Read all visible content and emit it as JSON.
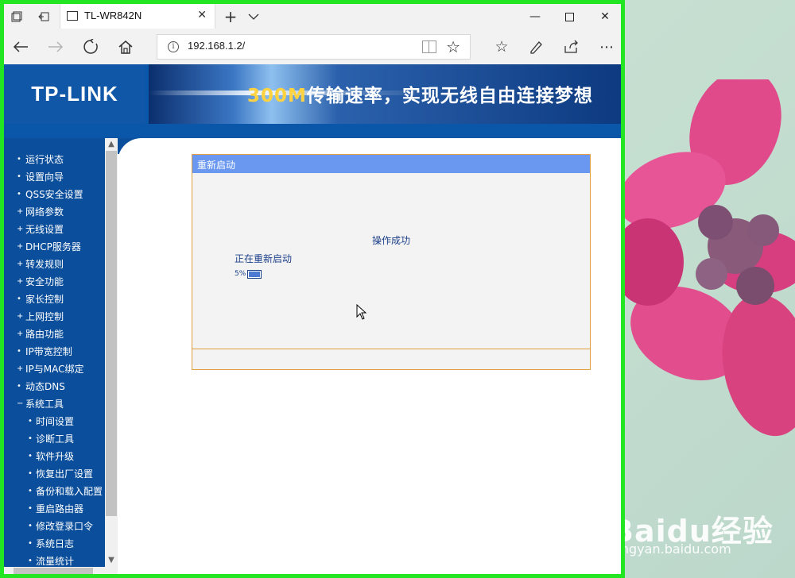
{
  "browser": {
    "tab_title": "TL-WR842N",
    "url": "192.168.1.2/"
  },
  "banner": {
    "logo": "TP-LINK",
    "slogan_highlight": "300M",
    "slogan_rest": "传输速率，实现无线自由连接梦想"
  },
  "sidebar": {
    "items": [
      {
        "label": "运行状态",
        "mark": "•"
      },
      {
        "label": "设置向导",
        "mark": "•"
      },
      {
        "label": "QSS安全设置",
        "mark": "•"
      },
      {
        "label": "网络参数",
        "mark": "+"
      },
      {
        "label": "无线设置",
        "mark": "+"
      },
      {
        "label": "DHCP服务器",
        "mark": "+"
      },
      {
        "label": "转发规则",
        "mark": "+"
      },
      {
        "label": "安全功能",
        "mark": "+"
      },
      {
        "label": "家长控制",
        "mark": "•"
      },
      {
        "label": "上网控制",
        "mark": "+"
      },
      {
        "label": "路由功能",
        "mark": "+"
      },
      {
        "label": "IP带宽控制",
        "mark": "•"
      },
      {
        "label": "IP与MAC绑定",
        "mark": "+"
      },
      {
        "label": "动态DNS",
        "mark": "•"
      },
      {
        "label": "系统工具",
        "mark": "−"
      },
      {
        "label": "时间设置",
        "mark": "•"
      },
      {
        "label": "诊断工具",
        "mark": "•"
      },
      {
        "label": "软件升级",
        "mark": "•"
      },
      {
        "label": "恢复出厂设置",
        "mark": "•"
      },
      {
        "label": "备份和载入配置",
        "mark": "•"
      },
      {
        "label": "重启路由器",
        "mark": "•"
      },
      {
        "label": "修改登录口令",
        "mark": "•"
      },
      {
        "label": "系统日志",
        "mark": "•"
      },
      {
        "label": "流量统计",
        "mark": "•"
      }
    ]
  },
  "panel": {
    "title": "重新启动",
    "status": "操作成功",
    "message": "正在重新启动",
    "progress_label": "5%",
    "progress_fraction": 0.05
  },
  "watermark": {
    "logo": "Baidu经验",
    "url": "jingyan.baidu.com"
  },
  "colors": {
    "window_border": "#22e622",
    "sidebar_bg": "#0b4f9c",
    "panel_header": "#6a98f0",
    "panel_border": "#e0a040"
  }
}
